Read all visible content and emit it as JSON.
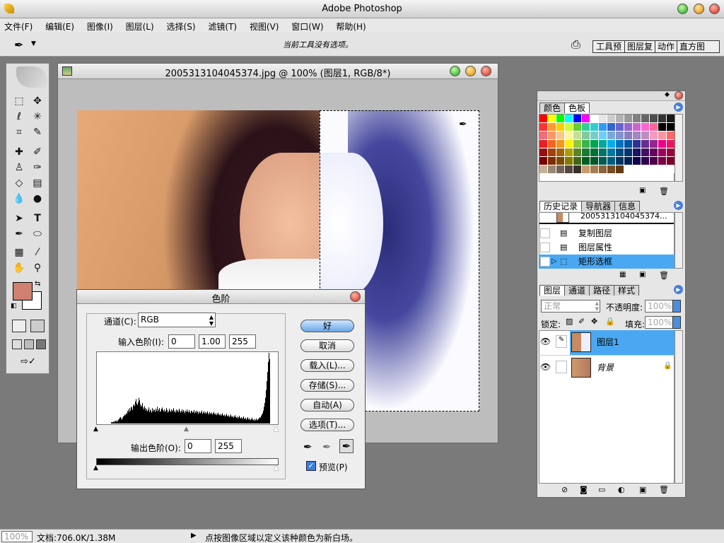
{
  "app": {
    "title": "Adobe Photoshop"
  },
  "menu": [
    "文件(F)",
    "编辑(E)",
    "图像(I)",
    "图层(L)",
    "选择(S)",
    "滤镜(T)",
    "视图(V)",
    "窗口(W)",
    "帮助(H)"
  ],
  "options_bar": {
    "message": "当前工具没有选项。",
    "palette_tabs": [
      "工具预",
      "图层复",
      "动作",
      "直方图"
    ]
  },
  "document": {
    "title": "2005313104045374.jpg @ 100% (图层1, RGB/8*)"
  },
  "levels_dialog": {
    "title": "色阶",
    "channel_label": "通道(C):",
    "channel_value": "RGB",
    "input_label": "输入色阶(I):",
    "input_values": [
      "0",
      "1.00",
      "255"
    ],
    "output_label": "输出色阶(O):",
    "output_values": [
      "0",
      "255"
    ],
    "buttons": {
      "ok": "好",
      "cancel": "取消",
      "load": "载入(L)...",
      "save": "存储(S)...",
      "auto": "自动(A)",
      "options": "选项(T)..."
    },
    "preview_label": "预览(P)"
  },
  "color_panel": {
    "tabs": [
      "颜色",
      "色板"
    ]
  },
  "history_panel": {
    "tabs": [
      "历史记录",
      "导航器",
      "信息"
    ],
    "snapshot": "2005313104045374...",
    "items": [
      "复制图层",
      "图层属性",
      "矩形选框"
    ]
  },
  "layers_panel": {
    "tabs": [
      "图层",
      "通道",
      "路径",
      "样式"
    ],
    "blend_mode": "正常",
    "opacity_label": "不透明度:",
    "opacity_value": "100%",
    "lock_label": "锁定:",
    "fill_label": "填充:",
    "fill_value": "100%",
    "layers": [
      "图层1",
      "背景"
    ]
  },
  "status_bar": {
    "zoom": "100%",
    "doc_info": "文档:706.0K/1.38M",
    "hint": "点按图像区域以定义该种颜色为新白场。"
  },
  "colors": {
    "accent": "#4aa8f2",
    "foreground_swatch": "#d08070",
    "histogram_fill": "#000000"
  },
  "histogram_levels": [
    0,
    0,
    0,
    0,
    0,
    0,
    0,
    0,
    0,
    0,
    0,
    0,
    0,
    0,
    0,
    0,
    0,
    0,
    0,
    0,
    2,
    2,
    2,
    3,
    2,
    4,
    4,
    3,
    5,
    3,
    6,
    7,
    9,
    10,
    8,
    6,
    9,
    11,
    12,
    14,
    13,
    16,
    15,
    19,
    22,
    18,
    24,
    20,
    26,
    25,
    21,
    28,
    30,
    27,
    34,
    38,
    31,
    29,
    33,
    40,
    36,
    30,
    26,
    28,
    32,
    25,
    22,
    27,
    24,
    20,
    23,
    19,
    21,
    25,
    18,
    22,
    20,
    17,
    24,
    19,
    22,
    21,
    18,
    23,
    20,
    26,
    19,
    22,
    24,
    18,
    20,
    23,
    25,
    21,
    19,
    22,
    18,
    20,
    24,
    21,
    17,
    19,
    23,
    20,
    18,
    22,
    19,
    21,
    24,
    18,
    20,
    17,
    22,
    19,
    21,
    18,
    23,
    20,
    17,
    19,
    22,
    18,
    21,
    19,
    16,
    20,
    18,
    22,
    19,
    17,
    21,
    18,
    16,
    20,
    19,
    17,
    18,
    21,
    16,
    19,
    17,
    20,
    18,
    15,
    19,
    17,
    16,
    18,
    20,
    15,
    17,
    19,
    16,
    18,
    15,
    17,
    19,
    16,
    14,
    18,
    16,
    15,
    17,
    14,
    16,
    18,
    15,
    14,
    16,
    13,
    15,
    17,
    14,
    13,
    15,
    12,
    14,
    16,
    13,
    12,
    14,
    11,
    13,
    15,
    12,
    11,
    13,
    10,
    12,
    14,
    11,
    10,
    12,
    9,
    11,
    13,
    10,
    9,
    11,
    8,
    10,
    12,
    9,
    8,
    10,
    7,
    9,
    11,
    8,
    7,
    9,
    6,
    8,
    10,
    7,
    6,
    8,
    5,
    7,
    9,
    6,
    5,
    7,
    4,
    6,
    8,
    5,
    6,
    7,
    8,
    10,
    9,
    12,
    14,
    16,
    20,
    26,
    32,
    40,
    52,
    66,
    80,
    96,
    110,
    100
  ]
}
